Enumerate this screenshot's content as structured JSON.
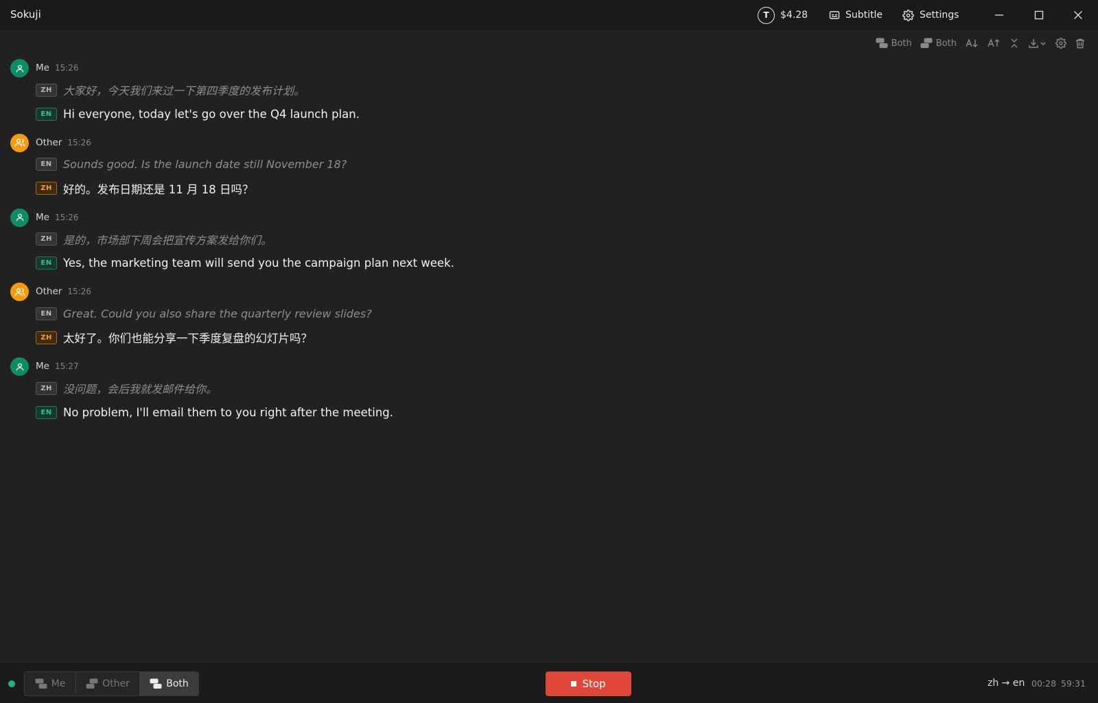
{
  "app": {
    "title": "Sokuji"
  },
  "titlebar": {
    "token_letter": "T",
    "balance": "$4.28",
    "subtitle_label": "Subtitle",
    "settings_label": "Settings"
  },
  "toolbar": {
    "view_mode_1": "Both",
    "view_mode_2": "Both"
  },
  "colors": {
    "me_avatar": "#0f8c63",
    "other_avatar": "#f39c12",
    "stop_button": "#e0473b",
    "status_dot": "#22b184"
  },
  "messages": [
    {
      "speaker": "Me",
      "time": "15:26",
      "src_lang": "ZH",
      "src_text": "大家好，今天我们来过一下第四季度的发布计划。",
      "tgt_lang": "EN",
      "tgt_text": "Hi everyone, today let's go over the Q4 launch plan."
    },
    {
      "speaker": "Other",
      "time": "15:26",
      "src_lang": "EN",
      "src_text": "Sounds good. Is the launch date still November 18?",
      "tgt_lang": "ZH",
      "tgt_text": "好的。发布日期还是 11 月 18 日吗？"
    },
    {
      "speaker": "Me",
      "time": "15:26",
      "src_lang": "ZH",
      "src_text": "是的，市场部下周会把宣传方案发给你们。",
      "tgt_lang": "EN",
      "tgt_text": "Yes, the marketing team will send you the campaign plan next week."
    },
    {
      "speaker": "Other",
      "time": "15:26",
      "src_lang": "EN",
      "src_text": "Great. Could you also share the quarterly review slides?",
      "tgt_lang": "ZH",
      "tgt_text": "太好了。你们也能分享一下季度复盘的幻灯片吗？"
    },
    {
      "speaker": "Me",
      "time": "15:27",
      "src_lang": "ZH",
      "src_text": "没问题，会后我就发邮件给你。",
      "tgt_lang": "EN",
      "tgt_text": "No problem, I'll email them to you right after the meeting."
    }
  ],
  "bottom": {
    "modes": [
      "Me",
      "Other",
      "Both"
    ],
    "active_mode": "Both",
    "stop_label": "Stop",
    "lang_pair": "zh → en",
    "elapsed": "00:28",
    "remaining": "59:31"
  }
}
